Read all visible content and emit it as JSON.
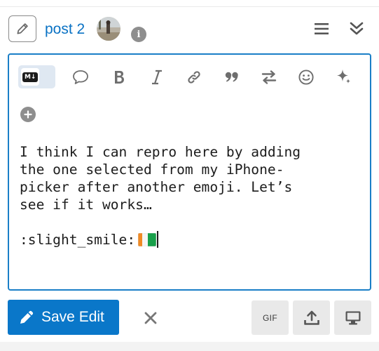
{
  "header": {
    "post_link": "post 2",
    "info_glyph": "i",
    "icons": [
      "pencil-icon",
      "avatar",
      "info-icon",
      "hamburger-menu-icon",
      "double-chevron-down-icon"
    ]
  },
  "toolbar": {
    "markdown_badge": "M↓",
    "icons": [
      "markdown-toggle",
      "speech-bubble-icon",
      "bold-icon",
      "italic-icon",
      "link-icon",
      "quote-icon",
      "swap-arrows-icon",
      "smiley-icon",
      "sparkle-icon",
      "plus-circle-icon"
    ]
  },
  "editor": {
    "lines": [
      "I think I can repro here by adding",
      "the one selected from my iPhone-",
      "picker after another emoji. Let’s",
      "see if it works…",
      "",
      ":slight_smile:"
    ],
    "trailing_emoji": "flag-cote-divoire"
  },
  "footer": {
    "save_label": "Save Edit",
    "gif_label": "GIF",
    "icons": [
      "pencil-icon",
      "close-icon",
      "upload-icon",
      "monitor-icon"
    ]
  },
  "colors": {
    "accent": "#0a77c9",
    "link": "#0a72c4",
    "editor_border": "#1a7fc7",
    "icon_gray": "#777777"
  }
}
